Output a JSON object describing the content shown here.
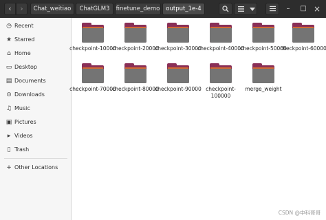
{
  "toolbar": {
    "back_icon": "chevron-left-icon",
    "forward_icon": "chevron-right-icon",
    "breadcrumbs": [
      "Chat_weitiao",
      "ChatGLM3",
      "finetune_demo",
      "output_1e-4"
    ],
    "search_icon": "search-icon",
    "view_icon": "list-view-icon",
    "menu_icon": "hamburger-menu-icon",
    "minimize_glyph": "–",
    "maximize_glyph": "□",
    "close_glyph": "×"
  },
  "sidebar": {
    "items": [
      {
        "label": "Recent",
        "icon": "clock-icon"
      },
      {
        "label": "Starred",
        "icon": "star-icon"
      },
      {
        "label": "Home",
        "icon": "home-icon"
      },
      {
        "label": "Desktop",
        "icon": "desktop-icon"
      },
      {
        "label": "Documents",
        "icon": "documents-icon"
      },
      {
        "label": "Downloads",
        "icon": "downloads-icon"
      },
      {
        "label": "Music",
        "icon": "music-icon"
      },
      {
        "label": "Pictures",
        "icon": "pictures-icon"
      },
      {
        "label": "Videos",
        "icon": "videos-icon"
      },
      {
        "label": "Trash",
        "icon": "trash-icon"
      },
      {
        "label": "Other Locations",
        "icon": "plus-icon"
      }
    ]
  },
  "folders": [
    {
      "name": "checkpoint-10000"
    },
    {
      "name": "checkpoint-20000"
    },
    {
      "name": "checkpoint-30000"
    },
    {
      "name": "checkpoint-40000"
    },
    {
      "name": "checkpoint-50000"
    },
    {
      "name": "checkpoint-60000"
    },
    {
      "name": "checkpoint-70000"
    },
    {
      "name": "checkpoint-80000"
    },
    {
      "name": "checkpoint-90000"
    },
    {
      "name": "checkpoint-100000"
    },
    {
      "name": "merge_weight"
    }
  ],
  "watermark": "CSDN @中科哥哥",
  "colors": {
    "headerbar": "#2d2d2d",
    "folder_tab": "#8a2f57",
    "folder_strip": "#d16a34",
    "folder_body": "#747474"
  }
}
